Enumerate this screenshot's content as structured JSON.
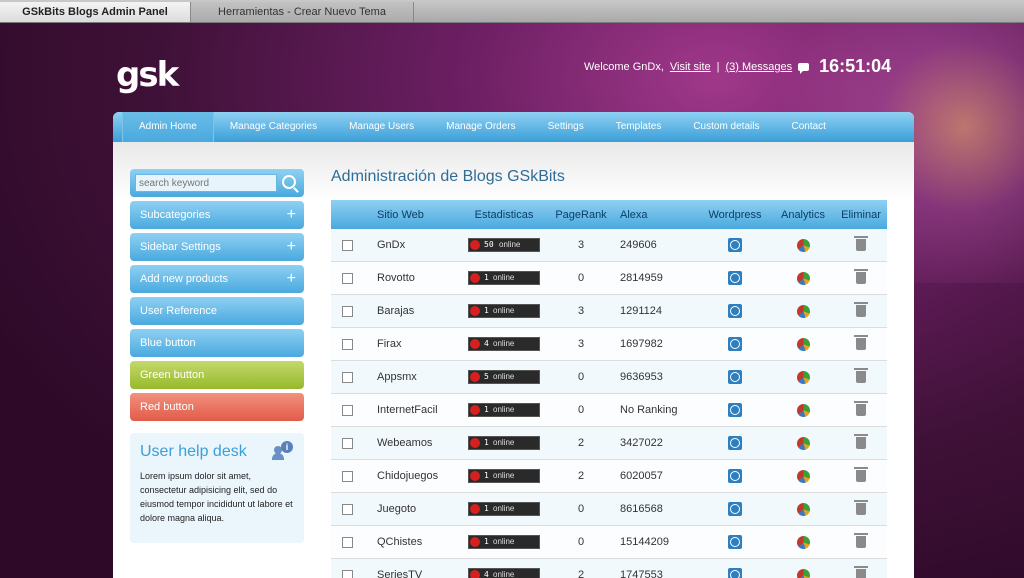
{
  "tabs": [
    "GSkBits Blogs Admin Panel",
    "Herramientas - Crear Nuevo Tema"
  ],
  "header": {
    "logo": "gsk",
    "welcome": "Welcome GnDx,",
    "visit_site": "Visit site",
    "separator": "|",
    "messages": "(3) Messages",
    "clock": "16:51:04"
  },
  "nav": [
    "Admin Home",
    "Manage Categories",
    "Manage Users",
    "Manage Orders",
    "Settings",
    "Templates",
    "Custom details",
    "Contact"
  ],
  "sidebar": {
    "search_placeholder": "search keyword",
    "buttons": [
      {
        "label": "Subcategories",
        "style": "blue",
        "expand": true
      },
      {
        "label": "Sidebar Settings",
        "style": "blue",
        "expand": true
      },
      {
        "label": "Add new products",
        "style": "blue",
        "expand": true
      },
      {
        "label": "User Reference",
        "style": "blue",
        "expand": false
      },
      {
        "label": "Blue button",
        "style": "blue",
        "expand": false
      },
      {
        "label": "Green button",
        "style": "green",
        "expand": false
      },
      {
        "label": "Red button",
        "style": "red",
        "expand": false
      }
    ],
    "help": {
      "title": "User help desk",
      "text": "Lorem ipsum dolor sit amet, consectetur adipisicing elit, sed do eiusmod tempor incididunt ut labore et dolore magna aliqua."
    }
  },
  "main": {
    "title": "Administración de Blogs GSkBits",
    "columns": [
      "Sitio Web",
      "Estadisticas",
      "PageRank",
      "Alexa",
      "Wordpress",
      "Analytics",
      "Eliminar"
    ],
    "online_label": "online",
    "rows": [
      {
        "site": "GnDx",
        "online": "50",
        "pagerank": "3",
        "alexa": "249606"
      },
      {
        "site": "Rovotto",
        "online": "1",
        "pagerank": "0",
        "alexa": "2814959"
      },
      {
        "site": "Barajas",
        "online": "1",
        "pagerank": "3",
        "alexa": "1291124"
      },
      {
        "site": "Firax",
        "online": "4",
        "pagerank": "3",
        "alexa": "1697982"
      },
      {
        "site": "Appsmx",
        "online": "5",
        "pagerank": "0",
        "alexa": "9636953"
      },
      {
        "site": "InternetFacil",
        "online": "1",
        "pagerank": "0",
        "alexa": "No Ranking"
      },
      {
        "site": "Webeamos",
        "online": "1",
        "pagerank": "2",
        "alexa": "3427022"
      },
      {
        "site": "Chidojuegos",
        "online": "1",
        "pagerank": "2",
        "alexa": "6020057"
      },
      {
        "site": "Juegoto",
        "online": "1",
        "pagerank": "0",
        "alexa": "8616568"
      },
      {
        "site": "QChistes",
        "online": "1",
        "pagerank": "0",
        "alexa": "15144209"
      },
      {
        "site": "SeriesTV",
        "online": "4",
        "pagerank": "2",
        "alexa": "1747553"
      }
    ]
  },
  "colors": {
    "accent": "#4aa9de",
    "green": "#97b92c",
    "red": "#e05b48"
  }
}
